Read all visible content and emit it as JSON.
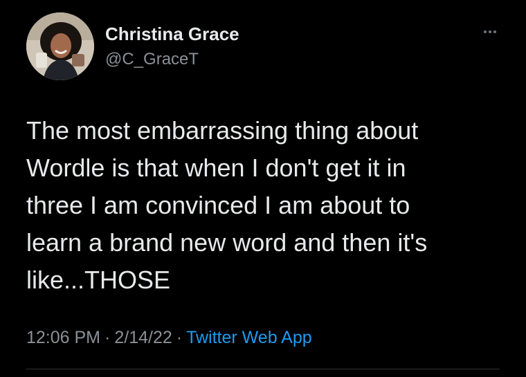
{
  "author": {
    "name": "Christina Grace",
    "handle": "@C_GraceT"
  },
  "tweet": {
    "text": "The most embarrassing thing about\nWordle is that when I don't get it in\nthree I am convinced I am about to\nlearn a brand new word and then it's\nlike...THOSE",
    "time": "12:06 PM",
    "date": "2/14/22",
    "separator": "·",
    "source": "Twitter Web App"
  },
  "icons": {
    "more": "more-horizontal-icon"
  },
  "colors": {
    "background": "#000000",
    "text": "#e7e9ea",
    "muted": "#8b9196",
    "link": "#1d9bf0"
  }
}
